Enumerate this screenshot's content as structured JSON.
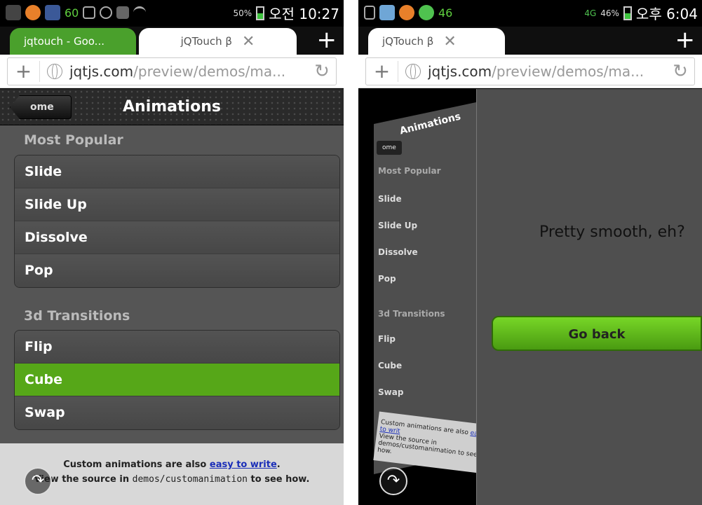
{
  "left": {
    "status": {
      "icons": [
        "plus-icon",
        "browser-icon",
        "facebook-icon",
        "badge-icon",
        "mute-icon",
        "alarm-icon",
        "device-icon",
        "wifi-icon"
      ],
      "badge": "60",
      "signal": "50%",
      "time": "오전 10:27",
      "battery_level": 0.5
    },
    "tabs": [
      {
        "label": "jqtouch - Goo...",
        "active": false
      },
      {
        "label": "jQTouch β",
        "active": true
      }
    ],
    "url": {
      "domain": "jqtjs.com",
      "path": "/preview/demos/ma..."
    },
    "toolbar": {
      "back_label": "ome",
      "title": "Animations"
    },
    "sections": [
      {
        "title": "Most Popular",
        "items": [
          "Slide",
          "Slide Up",
          "Dissolve",
          "Pop"
        ]
      },
      {
        "title": "3d Transitions",
        "items": [
          "Flip",
          "Cube",
          "Swap"
        ],
        "active": "Cube"
      }
    ],
    "footer": {
      "line1_text": "Custom animations are also ",
      "line1_link": "easy to write",
      "line1_end": ".",
      "line2_pre": "View the source in ",
      "line2_code": "demos/customanimation",
      "line2_post": " to see how."
    }
  },
  "right": {
    "status": {
      "icons": [
        "usb-icon",
        "paint-icon",
        "browser-icon",
        "circle-icon"
      ],
      "badge": "46",
      "network": "4G",
      "signal": "46%",
      "time": "오후 6:04",
      "battery_level": 0.46
    },
    "tabs": [
      {
        "label": "jQTouch β",
        "active": true
      }
    ],
    "url": {
      "domain": "jqtjs.com",
      "path": "/preview/demos/ma..."
    },
    "mini": {
      "title": "Animations",
      "back_label": "ome",
      "section1": "Most Popular",
      "items1": [
        "Slide",
        "Slide Up",
        "Dissolve",
        "Pop"
      ],
      "section2": "3d Transitions",
      "items2": [
        "Flip",
        "Cube",
        "Swap"
      ],
      "footer_text": "Custom animations are also ",
      "footer_link": "easy to writ",
      "footer_line2": "View the source in demos/customanimation to see how."
    },
    "message": "Pretty smooth, eh?",
    "go_back_label": "Go back"
  }
}
